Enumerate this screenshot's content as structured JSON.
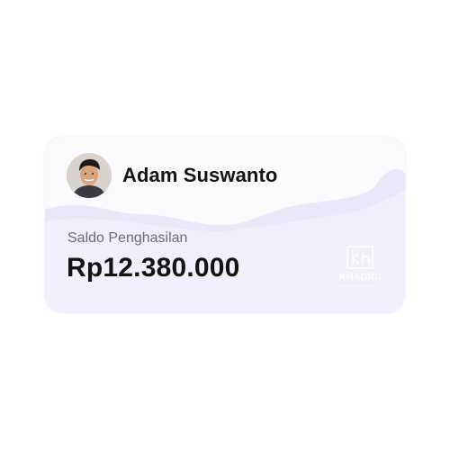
{
  "profile": {
    "name": "Adam Suswanto"
  },
  "balance": {
    "label": "Saldo Penghasilan",
    "amount": "Rp12.380.000"
  },
  "watermark": {
    "brand": "KHADIGI",
    "tagline": "BIKIN MU BERGENG"
  },
  "colors": {
    "card_background": "#f1effb",
    "card_top": "#fbfbfe",
    "text_primary": "#141414",
    "text_secondary": "#6b6b78",
    "watermark": "#ffffff"
  }
}
